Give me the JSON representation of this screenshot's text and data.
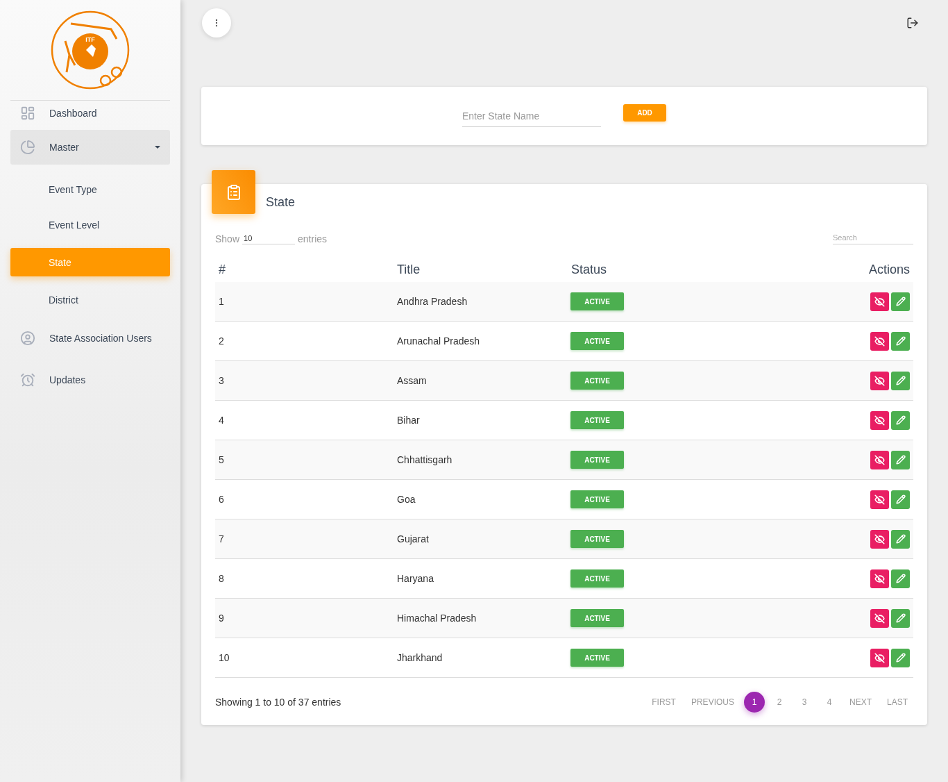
{
  "sidebar": {
    "logo_text": "ITF",
    "items": [
      {
        "kind": "dashboard",
        "label": "Dashboard",
        "selected": false
      },
      {
        "kind": "master",
        "label": "Master",
        "selected": false,
        "expanded": true,
        "children": [
          {
            "label": "Event Type",
            "selected": false
          },
          {
            "label": "Event Level",
            "selected": false
          },
          {
            "label": "State",
            "selected": true
          },
          {
            "label": "District",
            "selected": false
          }
        ]
      },
      {
        "kind": "users",
        "label": "State Association Users",
        "selected": false
      },
      {
        "kind": "updates",
        "label": "Updates",
        "selected": false
      }
    ]
  },
  "add_form": {
    "placeholder": "Enter State Name",
    "button": "ADD"
  },
  "table_card": {
    "title": "State",
    "show_label": "Show",
    "page_size": "10",
    "entries_label": "entries",
    "search_placeholder": "Search",
    "columns": [
      "#",
      "Title",
      "Status",
      "Actions"
    ],
    "rows": [
      {
        "number": "1",
        "title": "Andhra Pradesh",
        "status": "ACTIVE"
      },
      {
        "number": "2",
        "title": "Arunachal Pradesh",
        "status": "ACTIVE"
      },
      {
        "number": "3",
        "title": "Assam",
        "status": "ACTIVE"
      },
      {
        "number": "4",
        "title": "Bihar",
        "status": "ACTIVE"
      },
      {
        "number": "5",
        "title": "Chhattisgarh",
        "status": "ACTIVE"
      },
      {
        "number": "6",
        "title": "Goa",
        "status": "ACTIVE"
      },
      {
        "number": "7",
        "title": "Gujarat",
        "status": "ACTIVE"
      },
      {
        "number": "8",
        "title": "Haryana",
        "status": "ACTIVE"
      },
      {
        "number": "9",
        "title": "Himachal Pradesh",
        "status": "ACTIVE"
      },
      {
        "number": "10",
        "title": "Jharkhand",
        "status": "ACTIVE"
      }
    ],
    "summary": "Showing 1 to 10 of 37 entries",
    "pagination": [
      {
        "label": "FIRST",
        "selected": false
      },
      {
        "label": "PREVIOUS",
        "selected": false
      },
      {
        "label": "1",
        "selected": true
      },
      {
        "label": "2",
        "selected": false
      },
      {
        "label": "3",
        "selected": false
      },
      {
        "label": "4",
        "selected": false
      },
      {
        "label": "NEXT",
        "selected": false
      },
      {
        "label": "LAST",
        "selected": false
      }
    ]
  }
}
